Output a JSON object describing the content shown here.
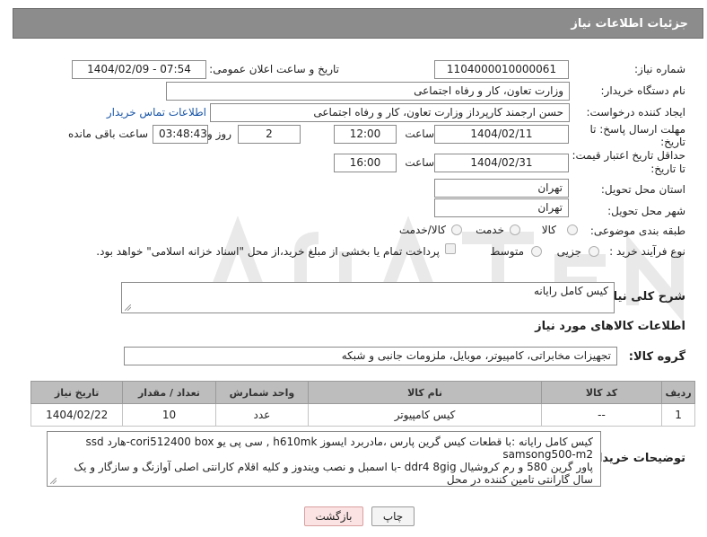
{
  "header": {
    "title": "جزئیات اطلاعات نیاز"
  },
  "need_number": {
    "label": "شماره نیاز:",
    "value": "1104000010000061"
  },
  "announce": {
    "label": "تاریخ و ساعت اعلان عمومی:",
    "value": "1404/02/09 - 07:54"
  },
  "buyer_org": {
    "label": "نام دستگاه خریدار:",
    "value": "وزارت تعاون، کار و رفاه اجتماعی"
  },
  "creator": {
    "label": "ایجاد کننده درخواست:",
    "value": "حسن ارجمند کارپرداز وزارت تعاون، کار و رفاه اجتماعی",
    "contact_link": "اطلاعات تماس خریدار"
  },
  "reply_deadline": {
    "label_line1": "مهلت ارسال پاسخ: تا",
    "label_line2": "تاریخ:",
    "date": "1404/02/11",
    "time_label": "ساعت",
    "time": "12:00",
    "days": "2",
    "days_label": "روز و",
    "remaining": "03:48:43",
    "remaining_label": "ساعت باقی مانده"
  },
  "price_validity": {
    "label_line1": "حداقل تاریخ اعتبار قیمت:",
    "label_line2": "تا تاریخ:",
    "date": "1404/02/31",
    "time_label": "ساعت",
    "time": "16:00"
  },
  "delivery_province": {
    "label": "استان محل تحویل:",
    "value": "تهران"
  },
  "delivery_city": {
    "label": "شهر محل تحویل:",
    "value": "تهران"
  },
  "category": {
    "label": "طبقه بندی موضوعی:",
    "options": [
      "کالا",
      "خدمت",
      "کالا/خدمت"
    ]
  },
  "purchase_type": {
    "label": "نوع فرآیند خرید :",
    "options": [
      "جزیی",
      "متوسط"
    ],
    "payment_note": "پرداخت تمام یا بخشی از مبلغ خرید،از محل \"اسناد خزانه اسلامی\" خواهد بود."
  },
  "description": {
    "label": "شرح کلی نیاز:",
    "value": "کیس کامل رایانه"
  },
  "goods_info": {
    "title": "اطلاعات کالاهای مورد نیاز"
  },
  "goods_group": {
    "label": "گروه کالا:",
    "value": "تجهیزات مخابراتی، کامپیوتر، موبایل، ملزومات جانبی و شبکه"
  },
  "table": {
    "headers": [
      "ردیف",
      "کد کالا",
      "نام کالا",
      "واحد شمارش",
      "تعداد / مقدار",
      "تاریخ نیاز"
    ],
    "rows": [
      {
        "row": "1",
        "code": "--",
        "name": "کیس کامپیوتر",
        "unit": "عدد",
        "qty": "10",
        "date": "1404/02/22"
      }
    ]
  },
  "buyer_notes": {
    "label": "توضیحات خریدار:",
    "line1": "کیس کامل رایانه :با قطعات کیس گرین پارس ،مادربرد ایسوز  h610mk  , سی پی یو cori512400 box-هارد ssd samsong500-m2",
    "line2": "پاور گرین 580 و رم کروشیال ddr4 8gig -با اسمبل و نصب ویندوز و کلیه اقلام کارانتی اصلی آوازنگ و سازگار و یک سال گارانتی تامین کننده در محل"
  },
  "buttons": {
    "print": "چاپ",
    "back": "بازگشت"
  },
  "colors": {
    "header_bg": "#8c8c8c",
    "table_header_bg": "#bdbdbd",
    "back_button_bg": "#fbe3e3",
    "link": "#1a57a8"
  }
}
